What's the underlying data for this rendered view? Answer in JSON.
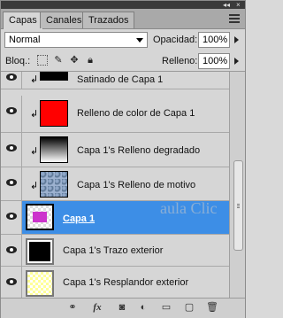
{
  "tabs": [
    {
      "label": "Capas",
      "active": true
    },
    {
      "label": "Canales",
      "active": false
    },
    {
      "label": "Trazados",
      "active": false
    }
  ],
  "blend_mode": "Normal",
  "opacity": {
    "label": "Opacidad:",
    "value": "100%"
  },
  "lock": {
    "label": "Bloq.:"
  },
  "fill": {
    "label": "Relleno:",
    "value": "100%"
  },
  "layers": [
    {
      "name": "Satinado de Capa 1",
      "clipped": true,
      "thumb": "black",
      "selected": false
    },
    {
      "name": "Relleno de color de Capa 1",
      "clipped": true,
      "thumb": "red",
      "selected": false
    },
    {
      "name": "Capa 1's Relleno degradado",
      "clipped": true,
      "thumb": "gradient",
      "selected": false
    },
    {
      "name": "Capa 1's Relleno de motivo",
      "clipped": true,
      "thumb": "pattern",
      "selected": false
    },
    {
      "name": "Capa 1",
      "clipped": false,
      "thumb": "magenta",
      "selected": true
    },
    {
      "name": "Capa 1's Trazo exterior",
      "clipped": false,
      "thumb": "black-border",
      "selected": false
    },
    {
      "name": "Capa 1's Resplandor exterior",
      "clipped": false,
      "thumb": "checker",
      "selected": false
    }
  ],
  "watermark": "aula Clic",
  "colors": {
    "selection": "#3d8ee6",
    "red_fill": "#ff0000",
    "magenta": "#cc33cc"
  }
}
